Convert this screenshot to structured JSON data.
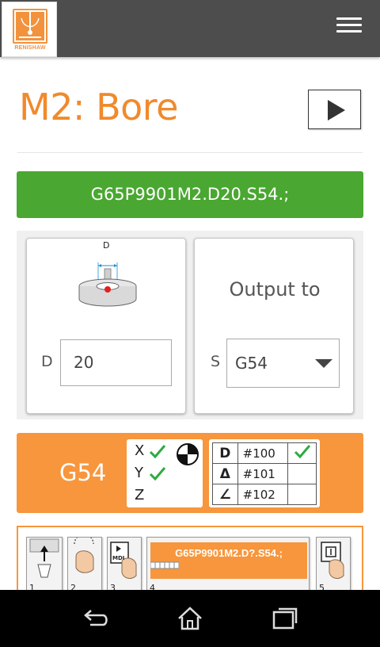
{
  "app": {
    "logo_text": "RENISHAW",
    "brand_color": "#f08a2c",
    "header_color": "#4d4d4d"
  },
  "page": {
    "title": "M2: Bore"
  },
  "code": {
    "value": "G65P9901M2.D20.S54.;",
    "color": "#4aa731"
  },
  "inputs": {
    "diameter": {
      "diagram_label": "D",
      "label": "D",
      "value": "20"
    },
    "output": {
      "heading": "Output to",
      "label": "S",
      "selected": "G54"
    }
  },
  "summary": {
    "label": "G54",
    "axes": [
      {
        "name": "X",
        "checked": true
      },
      {
        "name": "Y",
        "checked": true
      },
      {
        "name": "Z",
        "checked": false
      }
    ],
    "variables": [
      {
        "symbol": "D",
        "variable": "#100",
        "checked": true
      },
      {
        "symbol": "Δ",
        "variable": "#101",
        "checked": false
      },
      {
        "symbol": "∠",
        "variable": "#102",
        "checked": false
      }
    ]
  },
  "steps": {
    "items": [
      {
        "number": "1",
        "icon": "spindle-icon"
      },
      {
        "number": "2",
        "icon": "hand-rotate-icon"
      },
      {
        "number": "3",
        "icon": "mdi-press-icon",
        "icon_text": "MDI"
      },
      {
        "number": "4",
        "code": "G65P9901M2.D?.S54.;"
      },
      {
        "number": "5",
        "icon": "cycle-start-icon"
      }
    ]
  },
  "system_nav": {
    "items": [
      "back-icon",
      "home-icon",
      "recent-apps-icon"
    ]
  }
}
